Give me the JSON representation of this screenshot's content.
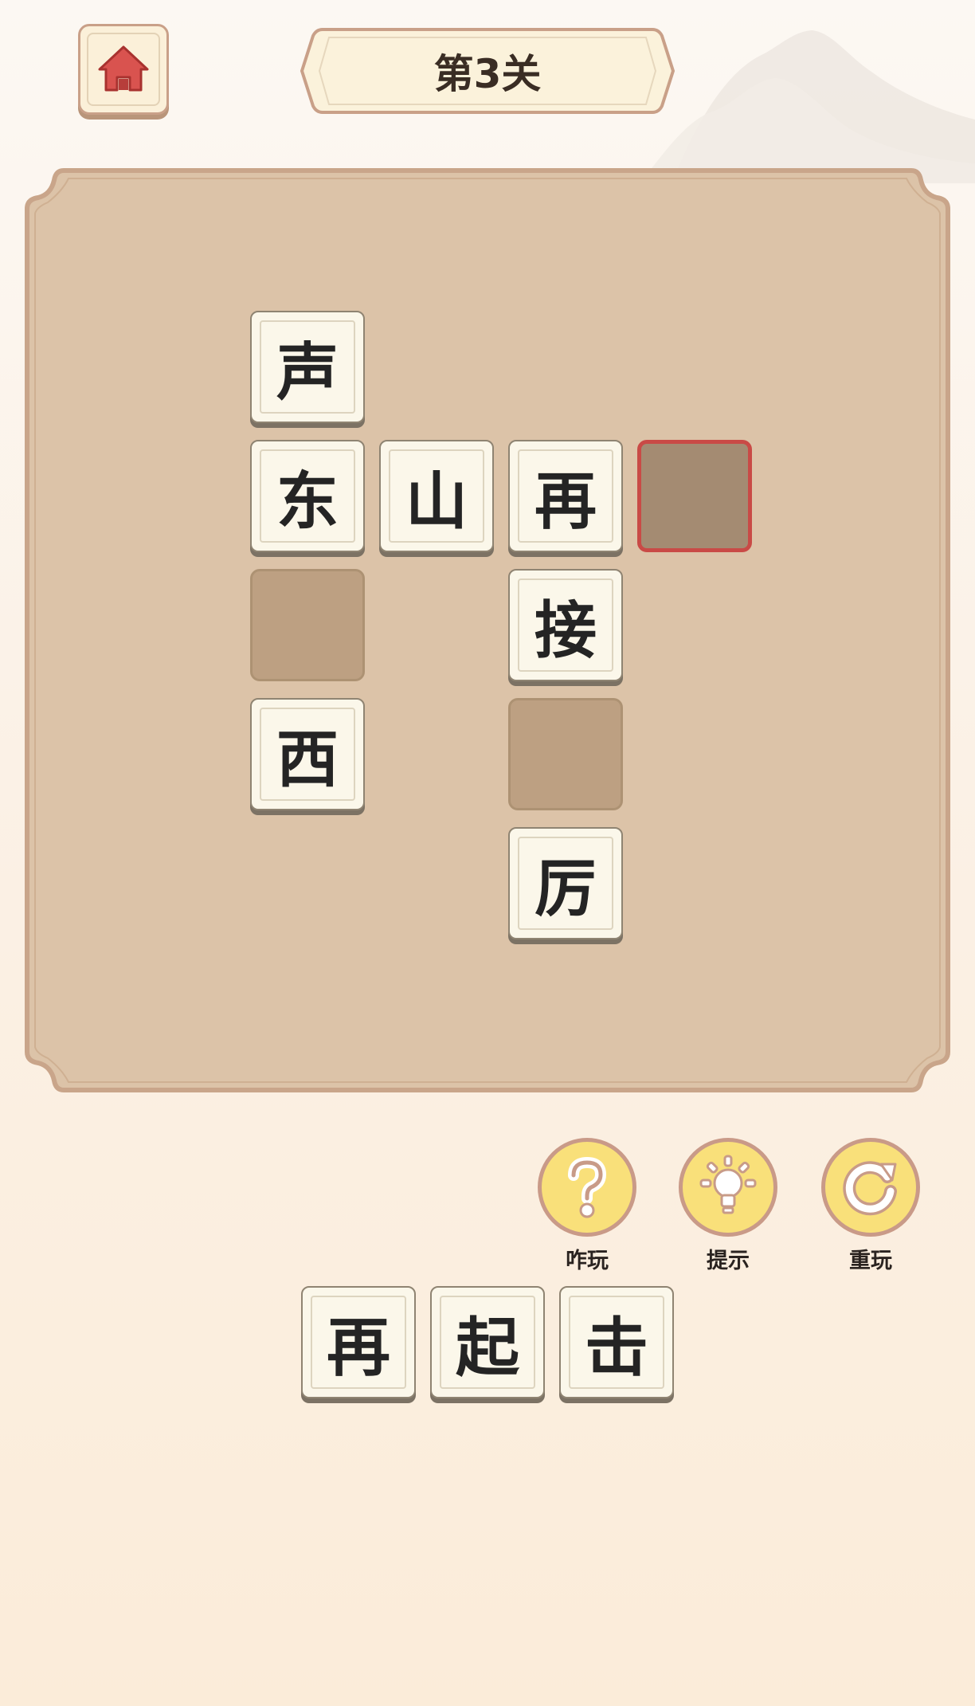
{
  "header": {
    "home_icon": "home-icon",
    "level_title": "第3关"
  },
  "colors": {
    "background": "#fcf6ee",
    "board": "#dcc3a8",
    "tile": "#fbf7ea",
    "slot": "#bda082",
    "active_slot_border": "#c94a46",
    "tool_button": "#f9e07a",
    "home_icon": "#d9534f"
  },
  "board": {
    "tiles": [
      {
        "char": "声"
      },
      {
        "char": "东"
      },
      {
        "char": "山"
      },
      {
        "char": "再"
      },
      {
        "char": "接"
      },
      {
        "char": "西"
      },
      {
        "char": "厉"
      }
    ],
    "empty_slots": 3,
    "active_slot": 1
  },
  "tools": [
    {
      "icon": "question-icon",
      "label": "咋玩"
    },
    {
      "icon": "lightbulb-icon",
      "label": "提示"
    },
    {
      "icon": "replay-icon",
      "label": "重玩"
    }
  ],
  "choices": [
    {
      "char": "再"
    },
    {
      "char": "起"
    },
    {
      "char": "击"
    }
  ]
}
